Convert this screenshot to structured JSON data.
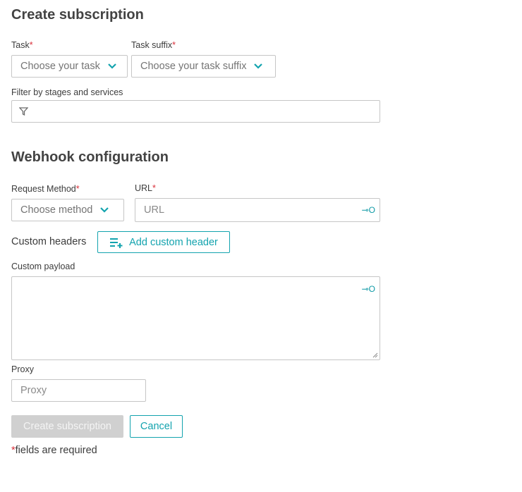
{
  "header": {
    "title": "Create subscription"
  },
  "task": {
    "label": "Task",
    "required_mark": "*",
    "value": "Choose your task"
  },
  "task_suffix": {
    "label": "Task suffix",
    "required_mark": "*",
    "value": "Choose your task suffix"
  },
  "filter": {
    "label": "Filter by stages and services",
    "value": ""
  },
  "webhook": {
    "title": "Webhook configuration",
    "request_method": {
      "label": "Request Method",
      "required_mark": "*",
      "value": "Choose method"
    },
    "url": {
      "label": "URL",
      "required_mark": "*",
      "placeholder": "URL"
    },
    "custom_headers": {
      "label": "Custom headers",
      "button": "Add custom header"
    },
    "custom_payload": {
      "label": "Custom payload",
      "value": ""
    },
    "proxy": {
      "label": "Proxy",
      "placeholder": "Proxy"
    }
  },
  "actions": {
    "create": "Create subscription",
    "cancel": "Cancel"
  },
  "footer": {
    "required_mark": "*",
    "required_note": "fields are required"
  },
  "colors": {
    "accent": "#13a3ae",
    "required": "#d9303a",
    "disabled": "#d0d0d0"
  },
  "icons": {
    "dropdown": "chevron-down-icon",
    "filter": "filter-icon",
    "secret": "key-icon",
    "add_header": "playlist-add-icon"
  }
}
